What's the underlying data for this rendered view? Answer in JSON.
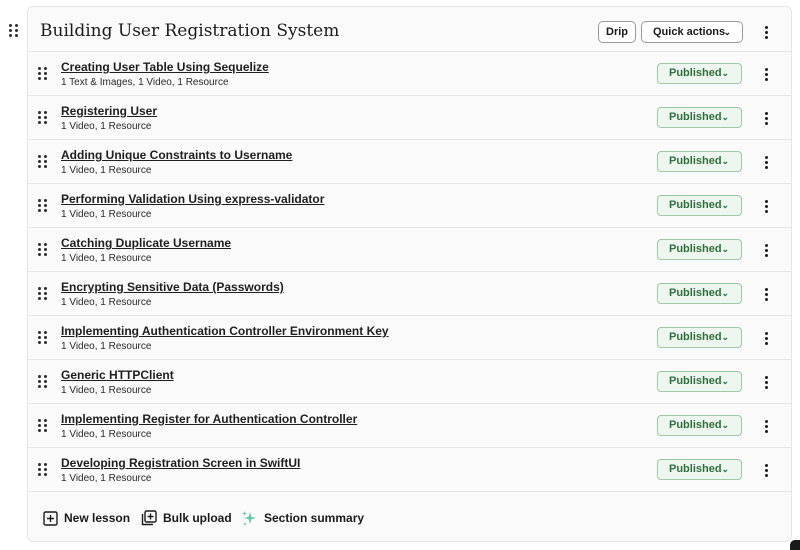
{
  "section": {
    "title": "Building User Registration System",
    "drip_label": "Drip",
    "quick_actions_label": "Quick actions"
  },
  "lessons": [
    {
      "title": "Creating User Table Using Sequelize",
      "meta": "1 Text & Images, 1 Video, 1 Resource",
      "status": "Published"
    },
    {
      "title": "Registering User",
      "meta": "1 Video, 1 Resource",
      "status": "Published"
    },
    {
      "title": "Adding Unique Constraints to Username",
      "meta": "1 Video, 1 Resource",
      "status": "Published"
    },
    {
      "title": "Performing Validation Using express-validator",
      "meta": "1 Video, 1 Resource",
      "status": "Published"
    },
    {
      "title": "Catching Duplicate Username",
      "meta": "1 Video, 1 Resource",
      "status": "Published"
    },
    {
      "title": "Encrypting Sensitive Data (Passwords)",
      "meta": "1 Video, 1 Resource",
      "status": "Published"
    },
    {
      "title": "Implementing Authentication Controller Environment Key",
      "meta": "1 Video, 1 Resource",
      "status": "Published"
    },
    {
      "title": "Generic HTTPClient",
      "meta": "1 Video, 1 Resource",
      "status": "Published"
    },
    {
      "title": "Implementing Register for Authentication Controller",
      "meta": "1 Video, 1 Resource",
      "status": "Published"
    },
    {
      "title": "Developing Registration Screen in SwiftUI",
      "meta": "1 Video, 1 Resource",
      "status": "Published"
    }
  ],
  "footer": {
    "new_lesson_label": "New lesson",
    "bulk_upload_label": "Bulk upload",
    "section_summary_label": "Section summary"
  },
  "icons": {
    "drag": "drag-handle-icon",
    "menu": "kebab-menu-icon",
    "chevron": "chevron-down-icon",
    "new_lesson": "plus-square-icon",
    "bulk_upload": "stacked-plus-icon",
    "section_summary": "sparkles-icon"
  },
  "colors": {
    "published_bg": "#eef7ef",
    "published_border": "#9ec9a6",
    "published_text": "#2f6f3c",
    "sparkle": "#5fc9a8"
  }
}
